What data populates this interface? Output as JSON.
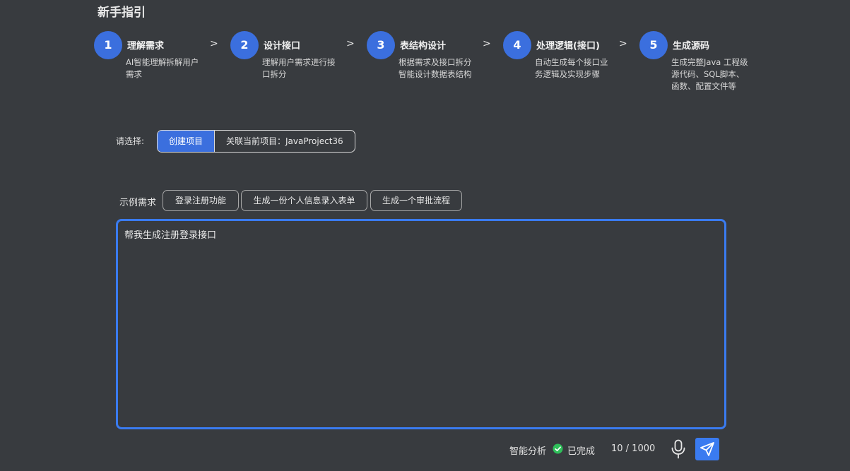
{
  "guide": {
    "title": "新手指引",
    "steps": [
      {
        "number": "1",
        "title": "理解需求",
        "desc": "AI智能理解拆解用户需求"
      },
      {
        "number": "2",
        "title": "设计接口",
        "desc": "理解用户需求进行接口拆分"
      },
      {
        "number": "3",
        "title": "表结构设计",
        "desc": "根据需求及接口拆分智能设计数据表结构"
      },
      {
        "number": "4",
        "title": "处理逻辑(接口)",
        "desc": "自动生成每个接口业务逻辑及实现步骤"
      },
      {
        "number": "5",
        "title": "生成源码",
        "desc": "生成完整Java 工程级源代码、SQL脚本、函数、配置文件等"
      }
    ],
    "arrow": ">"
  },
  "selection": {
    "label": "请选择:",
    "options": [
      "创建项目",
      "关联当前项目：JavaProject36"
    ],
    "selected": "创建项目"
  },
  "examples": {
    "label": "示例需求",
    "chips": [
      "登录注册功能",
      "生成一份个人信息录入表单",
      "生成一个审批流程"
    ]
  },
  "input": {
    "value": "帮我生成注册登录接口"
  },
  "footer": {
    "analysis_label": "智能分析",
    "status": "已完成",
    "counter": "10 / 1000"
  },
  "icons": {
    "status": "check-circle-icon",
    "voice": "microphone-icon",
    "send": "send-icon"
  },
  "colors": {
    "background": "#383b3f",
    "accent": "#3b6fde",
    "input_border": "#3a7bf0",
    "success": "#2fbf5a"
  }
}
